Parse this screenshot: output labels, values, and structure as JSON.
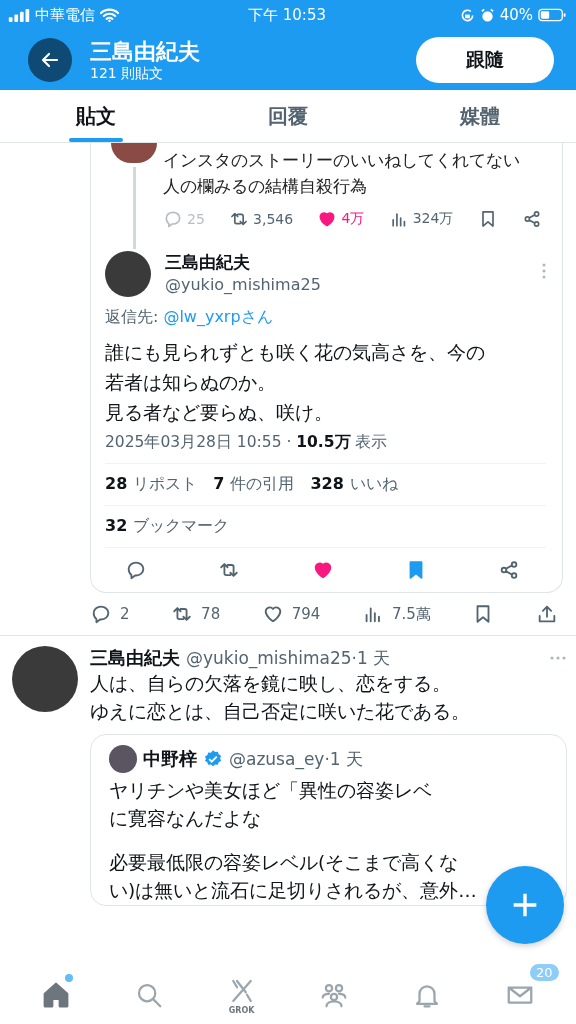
{
  "status_bar": {
    "carrier": "中華電信",
    "time": "下午 10:53",
    "battery": "40%"
  },
  "header": {
    "name": "三島由紀夫",
    "post_count": "121 則貼文",
    "follow_button": "跟隨"
  },
  "tabs": [
    {
      "label": "貼文",
      "selected": true
    },
    {
      "label": "回覆",
      "selected": false
    },
    {
      "label": "媒體",
      "selected": false
    }
  ],
  "screenshot": {
    "previous_post": {
      "lines": [
        "インスタのストーリーのいいねしてくれてない",
        "人の欄みるの結構自殺行為"
      ],
      "replies": "25",
      "reposts": "3,546",
      "likes": "4万",
      "liked": true,
      "views": "324万"
    },
    "reply": {
      "name": "三島由紀夫",
      "handle": "@yukio_mishima25",
      "reply_to_label": "返信先:",
      "reply_to": "@lw_yxrpさん",
      "lines": [
        "誰にも見られずとも咲く花の気高さを、今の",
        "若者は知らぬのか。",
        "見る者など要らぬ、咲け。"
      ],
      "timestamp": "2025年03月28日 10:55 · **10.5万** 表示",
      "counts": [
        {
          "number": "28",
          "label": "リポスト"
        },
        {
          "number": "7",
          "label": "件の引用"
        },
        {
          "number": "328",
          "label": "いいね"
        }
      ],
      "bookmarks": {
        "number": "32",
        "label": "ブックマーク"
      },
      "liked": true,
      "bookmarked": true
    }
  },
  "post_actions": {
    "replies": "2",
    "reposts": "78",
    "likes": "794",
    "liked": false,
    "views": "7.5萬",
    "bookmarked": false
  },
  "post": {
    "name": "三島由紀夫",
    "meta": "@yukio_mishima25·1 天",
    "lines": [
      "人は、自らの欠落を鏡に映し、恋をする。",
      "ゆえに恋とは、自己否定に咲いた花である。"
    ],
    "quote": {
      "name": "中野梓",
      "verified": true,
      "meta": "@azusa_ey·1 天",
      "lines": [
        "ヤリチンや美女ほど「異性の容姿レベ",
        "に寛容なんだよな"
      ],
      "more_lines": [
        "必要最低限の容姿レベル(そこまで高くな",
        "い)は無いと流石に足切りされるが、意外…"
      ]
    }
  },
  "bottom_nav": [
    {
      "kind": "home",
      "selected": true,
      "unread": true
    },
    {
      "kind": "search",
      "selected": false
    },
    {
      "kind": "grok",
      "selected": false,
      "label": "GROK"
    },
    {
      "kind": "communities",
      "selected": false
    },
    {
      "kind": "notifications",
      "selected": false
    },
    {
      "kind": "messages",
      "selected": false,
      "badge": "20"
    }
  ]
}
